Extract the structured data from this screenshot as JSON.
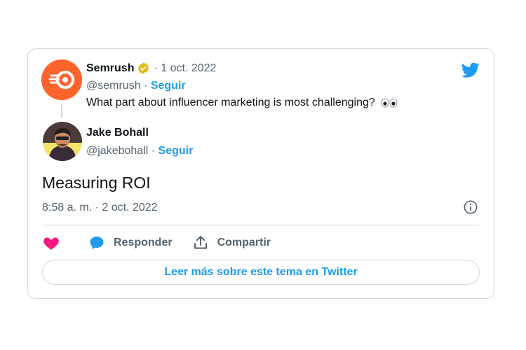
{
  "embed": {
    "parent_tweet": {
      "author_name": "Semrush",
      "date": "1 oct. 2022",
      "handle": "@semrush",
      "follow_label": "Seguir",
      "text": "What part about influencer marketing is most challenging?"
    },
    "reply_tweet": {
      "author_name": "Jake Bohall",
      "handle": "@jakebohall",
      "follow_label": "Seguir",
      "text": "Measuring ROI",
      "timestamp": "8:58 a. m. · 2 oct. 2022"
    },
    "actions": {
      "reply_label": "Responder",
      "share_label": "Compartir"
    },
    "read_more_label": "Leer más sobre este tema en Twitter",
    "separator": "·"
  },
  "colors": {
    "twitter_blue": "#1d9bf0",
    "like_pink": "#f91880",
    "semrush_orange": "#ff642d",
    "verified_gold": "#e2b719",
    "text_secondary": "#536471",
    "border": "#cfd9de"
  },
  "icons": [
    "twitter-bird-icon",
    "verified-badge-icon",
    "eyes-emoji-icon",
    "info-icon",
    "heart-icon",
    "reply-bubble-icon",
    "share-icon"
  ]
}
